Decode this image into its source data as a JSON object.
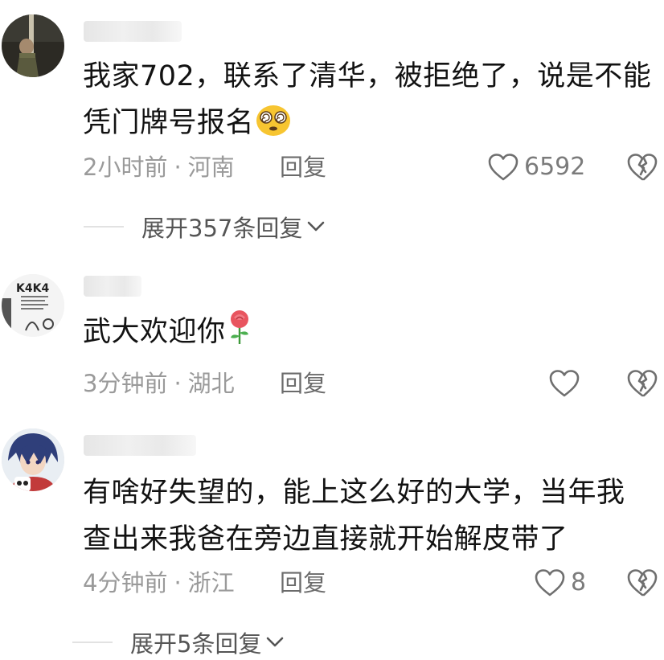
{
  "comments": [
    {
      "text_line1": "我家702，联系了清华，被拒绝了，说是不能",
      "text_line2": "凭门牌号报名",
      "emoji": "dizzy-face-emoji",
      "time": "2小时前",
      "sep": "·",
      "location": "河南",
      "reply_label": "回复",
      "like_count": "6592",
      "expand_label": "展开357条回复"
    },
    {
      "text_line1": "武大欢迎你",
      "emoji": "rose-emoji",
      "avatar_text": "K4K4",
      "time": "3分钟前",
      "sep": "·",
      "location": "湖北",
      "reply_label": "回复",
      "like_count": ""
    },
    {
      "text_line1": "有啥好失望的，能上这么好的大学，当年我",
      "text_line2": "查出来我爸在旁边直接就开始解皮带了",
      "time": "4分钟前",
      "sep": "·",
      "location": "浙江",
      "reply_label": "回复",
      "like_count": "8",
      "expand_label": "展开5条回复"
    }
  ],
  "colors": {
    "meta": "#9a9a9a",
    "icon": "#6f6f6f",
    "text": "#121212"
  }
}
